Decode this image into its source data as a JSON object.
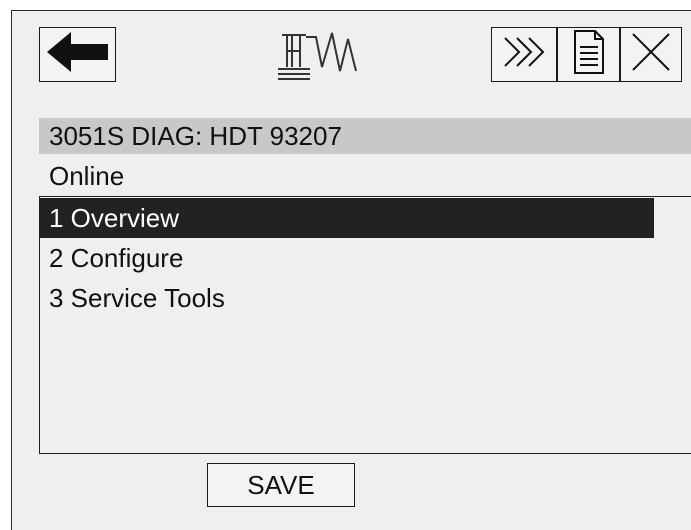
{
  "header": {
    "back_icon": "left-arrow-icon",
    "logo_icon": "hart-logo-icon",
    "forward_icon": "chevrons-right-icon",
    "document_icon": "document-icon",
    "close_icon": "close-x-icon"
  },
  "device": {
    "title": "3051S DIAG: HDT 93207"
  },
  "menu": {
    "label": "Online",
    "items": [
      {
        "label": "1 Overview",
        "selected": true
      },
      {
        "label": "2 Configure",
        "selected": false
      },
      {
        "label": "3 Service Tools",
        "selected": false
      }
    ]
  },
  "footer": {
    "save_label": "SAVE"
  },
  "colors": {
    "screen_bg": "#efefef",
    "title_bar_bg": "#c8c8c8",
    "selected_bg": "#222222",
    "selected_text": "#ffffff"
  }
}
